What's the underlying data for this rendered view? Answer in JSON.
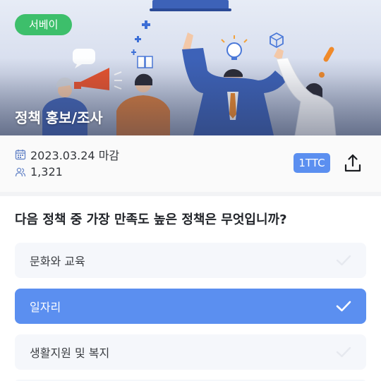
{
  "survey": {
    "category_tag": "서베이",
    "title": "정책 홍보/조사",
    "deadline": "2023.03.24 마감",
    "participants": "1,321",
    "reward_badge": "1TTC",
    "icons": [
      "calendar-icon",
      "people-icon",
      "share-icon",
      "check-icon"
    ]
  },
  "question": {
    "text": "다음 정책 중 가장 만족도 높은 정책은 무엇입니까?",
    "options": [
      {
        "label": "문화와 교육",
        "selected": false
      },
      {
        "label": "일자리",
        "selected": true
      },
      {
        "label": "생활지원 및 복지",
        "selected": false
      }
    ]
  },
  "colors": {
    "accent": "#5b8ff0",
    "tag": "#3dbf6b",
    "option_bg": "#f5f7fb"
  }
}
